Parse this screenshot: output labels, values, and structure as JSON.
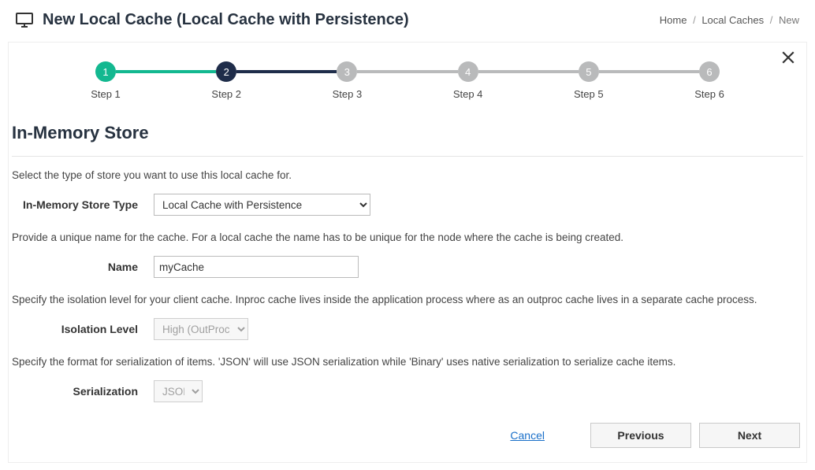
{
  "header": {
    "title": "New Local Cache (Local Cache with Persistence)",
    "breadcrumb": {
      "home": "Home",
      "caches": "Local Caches",
      "current": "New"
    }
  },
  "stepper": {
    "steps": [
      {
        "num": "1",
        "label": "Step 1",
        "state": "done"
      },
      {
        "num": "2",
        "label": "Step 2",
        "state": "active"
      },
      {
        "num": "3",
        "label": "Step 3",
        "state": "pending"
      },
      {
        "num": "4",
        "label": "Step 4",
        "state": "pending"
      },
      {
        "num": "5",
        "label": "Step 5",
        "state": "pending"
      },
      {
        "num": "6",
        "label": "Step 6",
        "state": "pending"
      }
    ]
  },
  "section": {
    "title": "In-Memory Store"
  },
  "form": {
    "store_desc": "Select the type of store you want to use this local cache for.",
    "store_label": "In-Memory Store Type",
    "store_value": "Local Cache with Persistence",
    "name_desc": "Provide a unique name for the cache. For a local cache the name has to be unique for the node where the cache is being created.",
    "name_label": "Name",
    "name_value": "myCache",
    "iso_desc": "Specify the isolation level for your client cache. Inproc cache lives inside the application process where as an outproc cache lives in a separate cache process.",
    "iso_label": "Isolation Level",
    "iso_value": "High (OutProc)",
    "ser_desc": "Specify the format for serialization of items. 'JSON' will use JSON serialization while 'Binary' uses native serialization to serialize cache items.",
    "ser_label": "Serialization",
    "ser_value": "JSON"
  },
  "footer": {
    "cancel": "Cancel",
    "previous": "Previous",
    "next": "Next"
  }
}
